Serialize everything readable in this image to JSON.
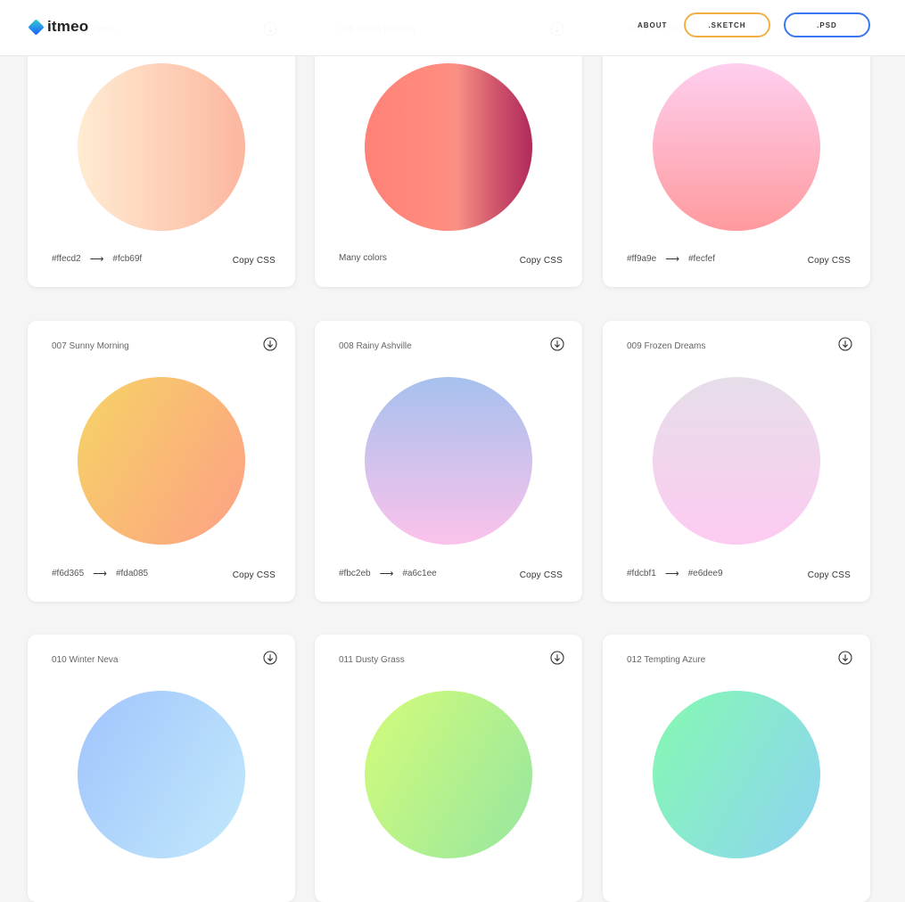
{
  "header": {
    "logo_text": "itmeo",
    "about_label": "ABOUT",
    "sketch_label": ".SKETCH",
    "psd_label": ".PSD"
  },
  "copy_label": "Copy CSS",
  "cards": [
    {
      "title": "004 Juicy Peach",
      "from": "#ffecd2",
      "to": "#fcb69f",
      "meta": null
    },
    {
      "title": "005 Young Passion",
      "from": null,
      "to": null,
      "meta": "Many colors"
    },
    {
      "title": "006 Lady Lips",
      "from": "#ff9a9e",
      "to": "#fecfef",
      "meta": null
    },
    {
      "title": "007 Sunny Morning",
      "from": "#f6d365",
      "to": "#fda085",
      "meta": null
    },
    {
      "title": "008 Rainy Ashville",
      "from": "#fbc2eb",
      "to": "#a6c1ee",
      "meta": null
    },
    {
      "title": "009 Frozen Dreams",
      "from": "#fdcbf1",
      "to": "#e6dee9",
      "meta": null
    },
    {
      "title": "010 Winter Neva",
      "from": null,
      "to": null,
      "meta": null
    },
    {
      "title": "011 Dusty Grass",
      "from": null,
      "to": null,
      "meta": null
    },
    {
      "title": "012 Tempting Azure",
      "from": null,
      "to": null,
      "meta": null
    }
  ],
  "gradient_colors": {
    "juicy_peach": [
      "#ffecd2",
      "#fcb69f"
    ],
    "young_passion": [
      "#ff8177",
      "#ff867a",
      "#ff8c7f",
      "#f99185",
      "#cf556c",
      "#b12a5b"
    ],
    "lady_lips": [
      "#ff9a9e",
      "#fecfef"
    ],
    "sunny_morning": [
      "#f6d365",
      "#fda085"
    ],
    "rainy_ashville": [
      "#a6c1ee",
      "#fbc2eb"
    ],
    "frozen_dreams": [
      "#e6dee9",
      "#fdcbf1"
    ],
    "winter_neva": [
      "#a1c4fd",
      "#c2e9fb"
    ],
    "dusty_grass": [
      "#d4fc79",
      "#96e6a1"
    ],
    "tempting_azure": [
      "#84fab0",
      "#8fd3f4"
    ]
  }
}
